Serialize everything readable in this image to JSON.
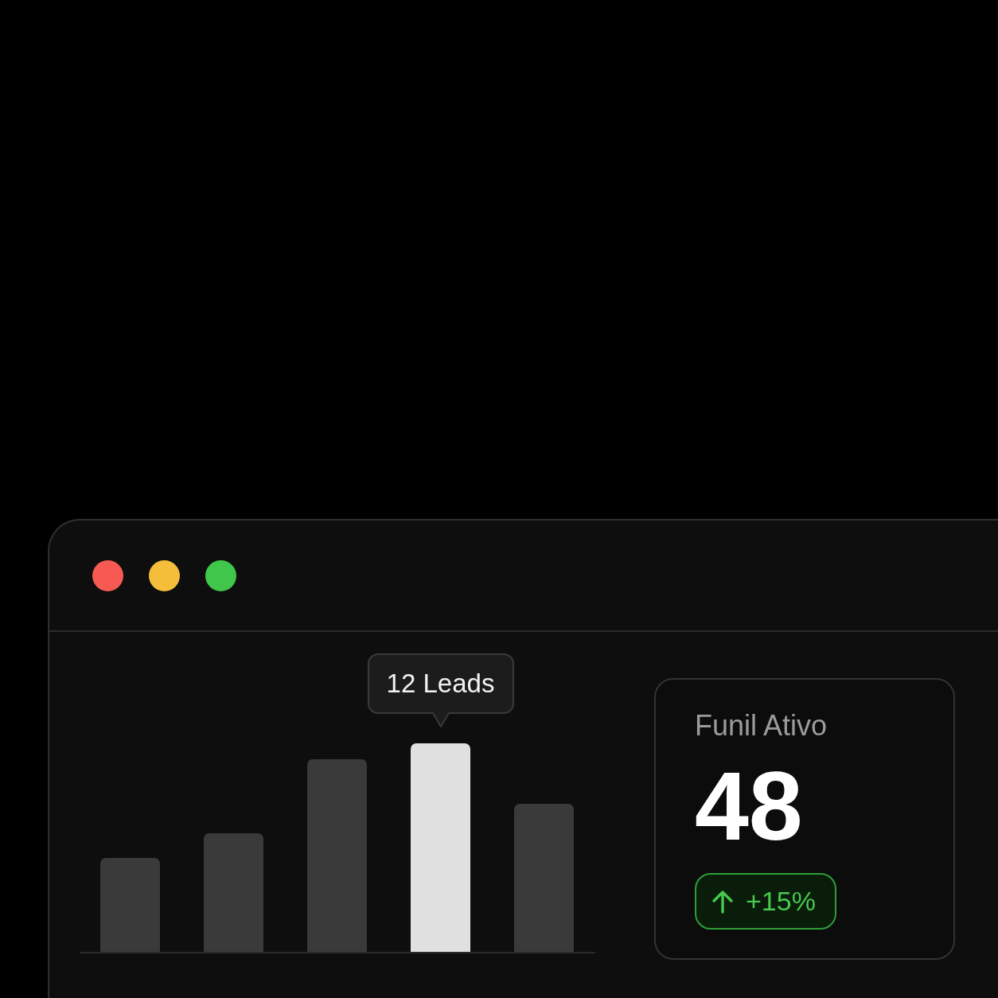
{
  "window": {
    "buttons": [
      {
        "color": "#f65a52"
      },
      {
        "color": "#f5be3a"
      },
      {
        "color": "#40c64a"
      }
    ]
  },
  "chart": {
    "tooltip": "12 Leads",
    "bars": [
      {
        "selected": false
      },
      {
        "selected": false
      },
      {
        "selected": false
      },
      {
        "selected": true
      },
      {
        "selected": false
      }
    ]
  },
  "card": {
    "title": "Funil Ativo",
    "value": "48",
    "change": {
      "rising": true,
      "label": "+15%"
    }
  }
}
